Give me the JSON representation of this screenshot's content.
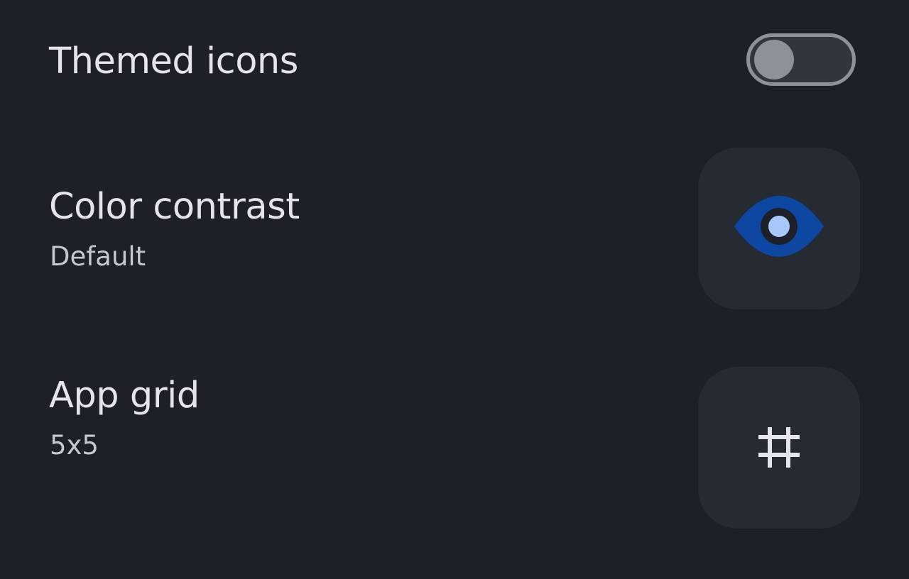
{
  "settings": {
    "themed_icons": {
      "title": "Themed icons",
      "enabled": false,
      "toggle_color": "#8f9199"
    },
    "color_contrast": {
      "title": "Color contrast",
      "value": "Default",
      "icon": "eye-icon",
      "icon_color": "#0d47a1",
      "icon_pupil_color": "#a8c7fa"
    },
    "app_grid": {
      "title": "App grid",
      "value": "5x5",
      "icon": "grid-icon"
    }
  },
  "colors": {
    "background": "#1d2029",
    "tile": "#262a33",
    "text_primary": "#e3e4ec",
    "text_secondary": "#c5c7d2"
  }
}
